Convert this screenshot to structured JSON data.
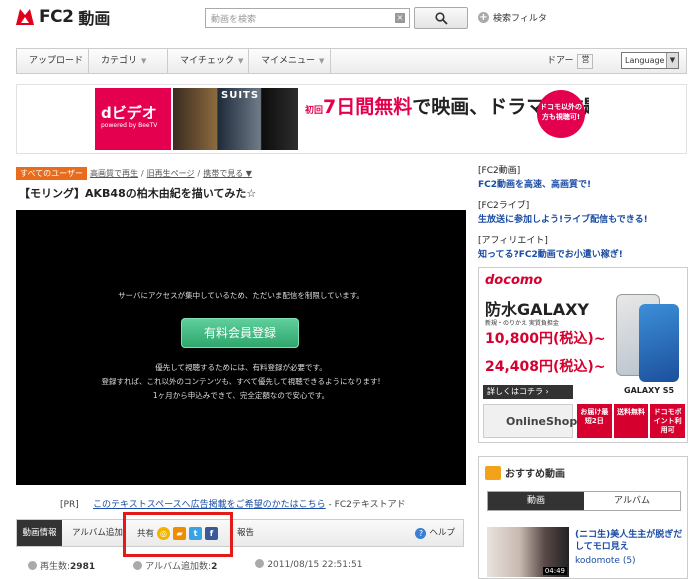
{
  "header": {
    "logo_text": "FC2",
    "logo_sub": "動画",
    "search_placeholder": "動画を検索",
    "filter_label": "検索フィルタ"
  },
  "nav": {
    "items": [
      {
        "label": "アップロード",
        "arrow": false
      },
      {
        "label": "カテゴリ",
        "arrow": true
      },
      {
        "label": "マイチェック",
        "arrow": true
      },
      {
        "label": "マイメニュー",
        "arrow": true
      }
    ],
    "door_label": "ドアー",
    "door_value": "営",
    "language_label": "Language"
  },
  "banner": {
    "brand": "dビデオ",
    "brand_sub": "powered by BeeTV",
    "poster_title": "SUITS",
    "headline_prefix": "初回",
    "headline_days": "7日間",
    "headline_free": "無料",
    "headline_rest": "で映画、ドラマ見放題!",
    "badge": "ドコモ以外の方も視聴可!"
  },
  "breadcrumb": {
    "tag": "すべてのユーザー",
    "items": [
      "高画質で再生",
      "旧再生ページ",
      "携帯で見る ▼"
    ]
  },
  "video": {
    "title": "【モリング】AKB48の柏木由紀を描いてみた☆",
    "server_msg": "サーバにアクセスが集中しているため、ただいま配信を制限しています。",
    "premium_button": "有料会員登録",
    "info1": "優先して視聴するためには、有料登録が必要です。",
    "info2": "登録すれば、これ以外のコンテンツも、すべて優先して視聴できるようになります!",
    "info3": "1ヶ月から申込みできて、完全定額なので安心です。"
  },
  "pr": {
    "tag": "[PR]",
    "link": "このテキストスペースへ広告掲載をご希望のかたはこちら",
    "suffix": "- FC2テキストアド"
  },
  "tabs": {
    "info": "動画情報",
    "album": "アルバム追加",
    "share": "共有",
    "report": "報告",
    "help": "ヘルプ"
  },
  "stats": {
    "plays_label": "再生数:",
    "plays": "2981",
    "album_label": "アルバム追加数:",
    "album": "2",
    "date": "2011/08/15 22:51:51"
  },
  "sidebar": {
    "fc2video_heading": "[FC2動画]",
    "fc2video_link": "FC2動画を高速、高画質で!",
    "fc2live_heading": "[FC2ライブ]",
    "fc2live_link": "生放送に参加しよう!ライブ配信もできる!",
    "affiliate_heading": "[アフィリエイト]",
    "affiliate_link": "知ってる?FC2動画でお小遣い稼ぎ!"
  },
  "docomo_ad": {
    "logo": "docomo",
    "product": "防水GALAXY",
    "caption1": "新規・のりかえ 実質負担金",
    "price1": "10,800円(税込)~",
    "price2": "24,408円(税込)~",
    "model": "GALAXY S5",
    "more": "詳しくはコチラ ›",
    "shop": "OnlineShop",
    "tiles": [
      "お届け最短2日",
      "送料無料",
      "ドコモポイント利用可"
    ]
  },
  "recommend": {
    "title": "おすすめ動画",
    "tab_video": "動画",
    "tab_album": "アルバム",
    "item_title": "(ニコ生)美人生主が脱ぎだしてモロ見え",
    "item_user": "kodomote (5)",
    "item_duration": "04:49"
  },
  "colors": {
    "accent_link": "#1a4da3",
    "tag_orange": "#e86c1c",
    "premium_green": "#2fa66d",
    "highlight_red": "#e21a1a"
  }
}
